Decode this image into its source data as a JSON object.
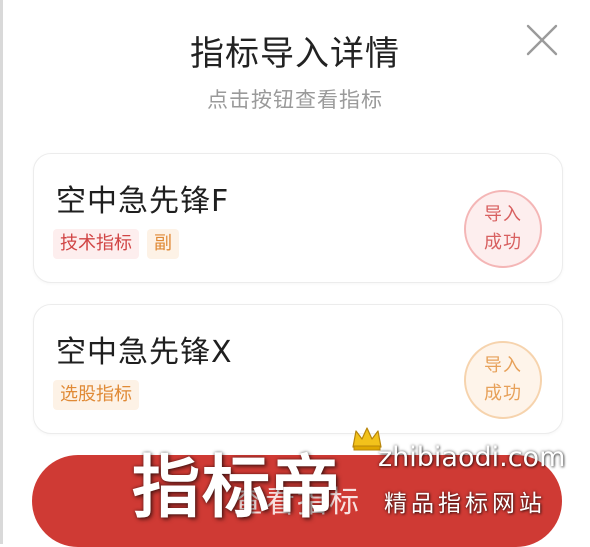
{
  "dialog": {
    "title": "指标导入详情",
    "subtitle": "点击按钮查看指标",
    "close_icon": "close-icon"
  },
  "indicators": [
    {
      "name": "空中急先锋F",
      "tags": [
        "技术指标",
        "副"
      ],
      "status_line1": "导入",
      "status_line2": "成功",
      "accent": "#d86060"
    },
    {
      "name": "空中急先锋X",
      "tags": [
        "选股指标"
      ],
      "status_line1": "导入",
      "status_line2": "成功",
      "accent": "#e7a15a"
    }
  ],
  "primary_button": {
    "label": "查看指标",
    "color": "#cf3a34"
  },
  "watermark": {
    "logo_text": "指标帝",
    "url": "zhibiaodi.com",
    "slogan": "精品指标网站"
  }
}
